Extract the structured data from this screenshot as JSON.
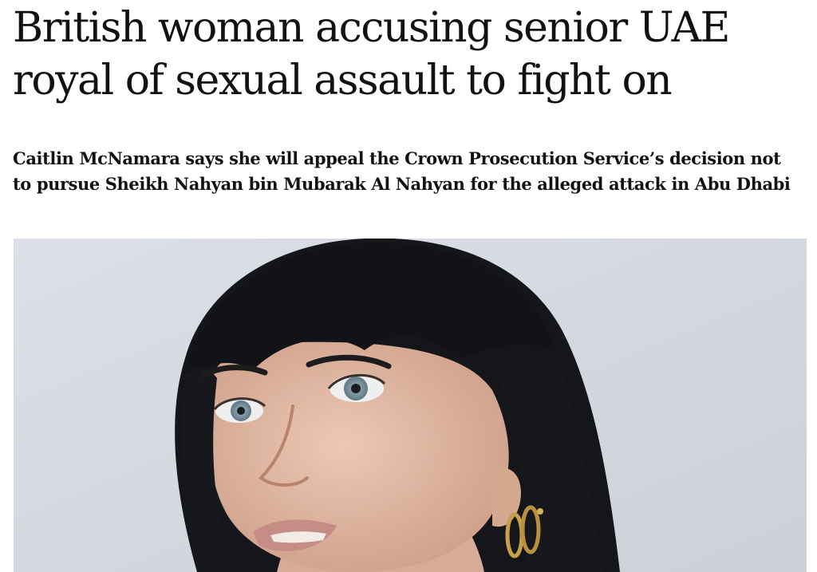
{
  "article": {
    "headline": "British woman accusing senior UAE royal of sexual assault to fight on",
    "standfirst": "Caitlin McNamara says she will appeal the Crown Prosecution Service’s decision not to pursue Sheikh Nahyan bin Mubarak Al Nahyan for the alleged attack in Abu Dhabi"
  },
  "photo": {
    "subject": "portrait-woman-dark-fringe",
    "colors": {
      "background": "#d8dbe3",
      "hair": "#15161a",
      "skin": "#e2b9a3",
      "eyes": "#7f9aa6",
      "lips": "#c58d86",
      "earring": "#c7a04a"
    }
  }
}
